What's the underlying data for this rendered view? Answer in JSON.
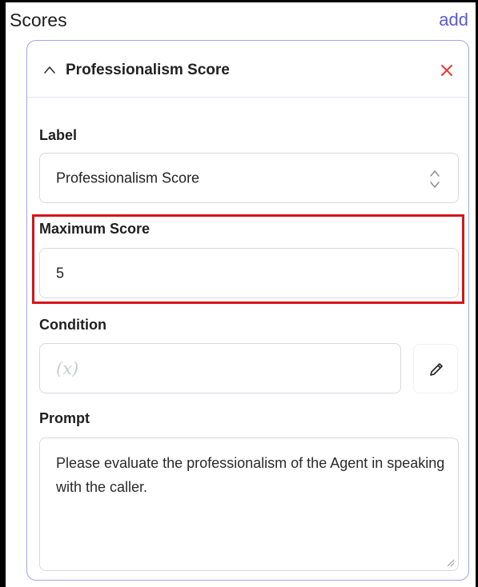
{
  "header": {
    "title": "Scores",
    "add_label": "add"
  },
  "score_card": {
    "title": "Professionalism Score",
    "label_field": {
      "label": "Label",
      "value": "Professionalism Score"
    },
    "max_score_field": {
      "label": "Maximum Score",
      "value": "5"
    },
    "condition_field": {
      "label": "Condition",
      "placeholder": "(x)"
    },
    "prompt_field": {
      "label": "Prompt",
      "value": "Please evaluate the professionalism of the Agent in speaking with the caller."
    }
  },
  "colors": {
    "accent": "#5a5ad6",
    "card_border": "#9fa5e6",
    "close": "#e53935",
    "highlight": "#d7141a"
  },
  "icons": {
    "collapse": "chevron-up-icon",
    "remove": "close-icon",
    "stepper": "up-down-chevron-icon",
    "edit": "pencil-icon",
    "resize": "resize-handle-icon"
  }
}
